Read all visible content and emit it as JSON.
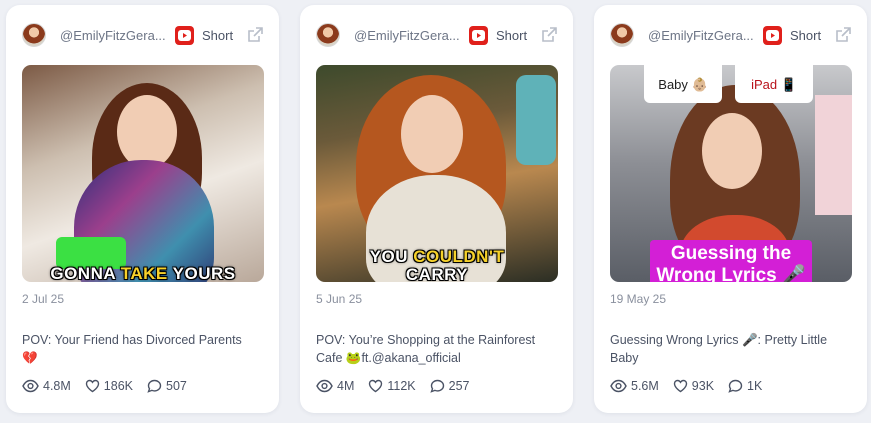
{
  "cards": [
    {
      "handle": "@EmilyFitzGera...",
      "type_label": "Short",
      "thumb_caption": {
        "pre": "GONNA ",
        "highlight": "TAKE",
        "post": " YOURS"
      },
      "date": "2 Jul 25",
      "title": "POV: Your Friend has Divorced Parents 💔",
      "views": "4.8M",
      "likes": "186K",
      "comments": "507"
    },
    {
      "handle": "@EmilyFitzGera...",
      "type_label": "Short",
      "thumb_caption": {
        "pre": "YOU ",
        "highlight": "COULDN'T",
        "post": "",
        "line2": "CARRY"
      },
      "date": "5 Jun 25",
      "title": "POV: You’re Shopping at the Rainforest Cafe 🐸ft.@akana_official",
      "views": "4M",
      "likes": "112K",
      "comments": "257"
    },
    {
      "handle": "@EmilyFitzGera...",
      "type_label": "Short",
      "thumb_tags": {
        "baby": "Baby 👶🏼",
        "ipad": "iPad 📱"
      },
      "thumb_overlay": "Guessing the Wrong Lyrics 🎤",
      "date": "19 May 25",
      "title": "Guessing Wrong Lyrics 🎤: Pretty Little Baby",
      "views": "5.6M",
      "likes": "93K",
      "comments": "1K"
    }
  ],
  "icons": [
    "avatar",
    "youtube-icon",
    "external-link-icon",
    "eye-icon",
    "heart-icon",
    "comment-icon"
  ],
  "colors": {
    "youtube_red": "#e0201b",
    "overlay_magenta": "#d31fd6",
    "caption_yellow": "#f6d12a"
  }
}
